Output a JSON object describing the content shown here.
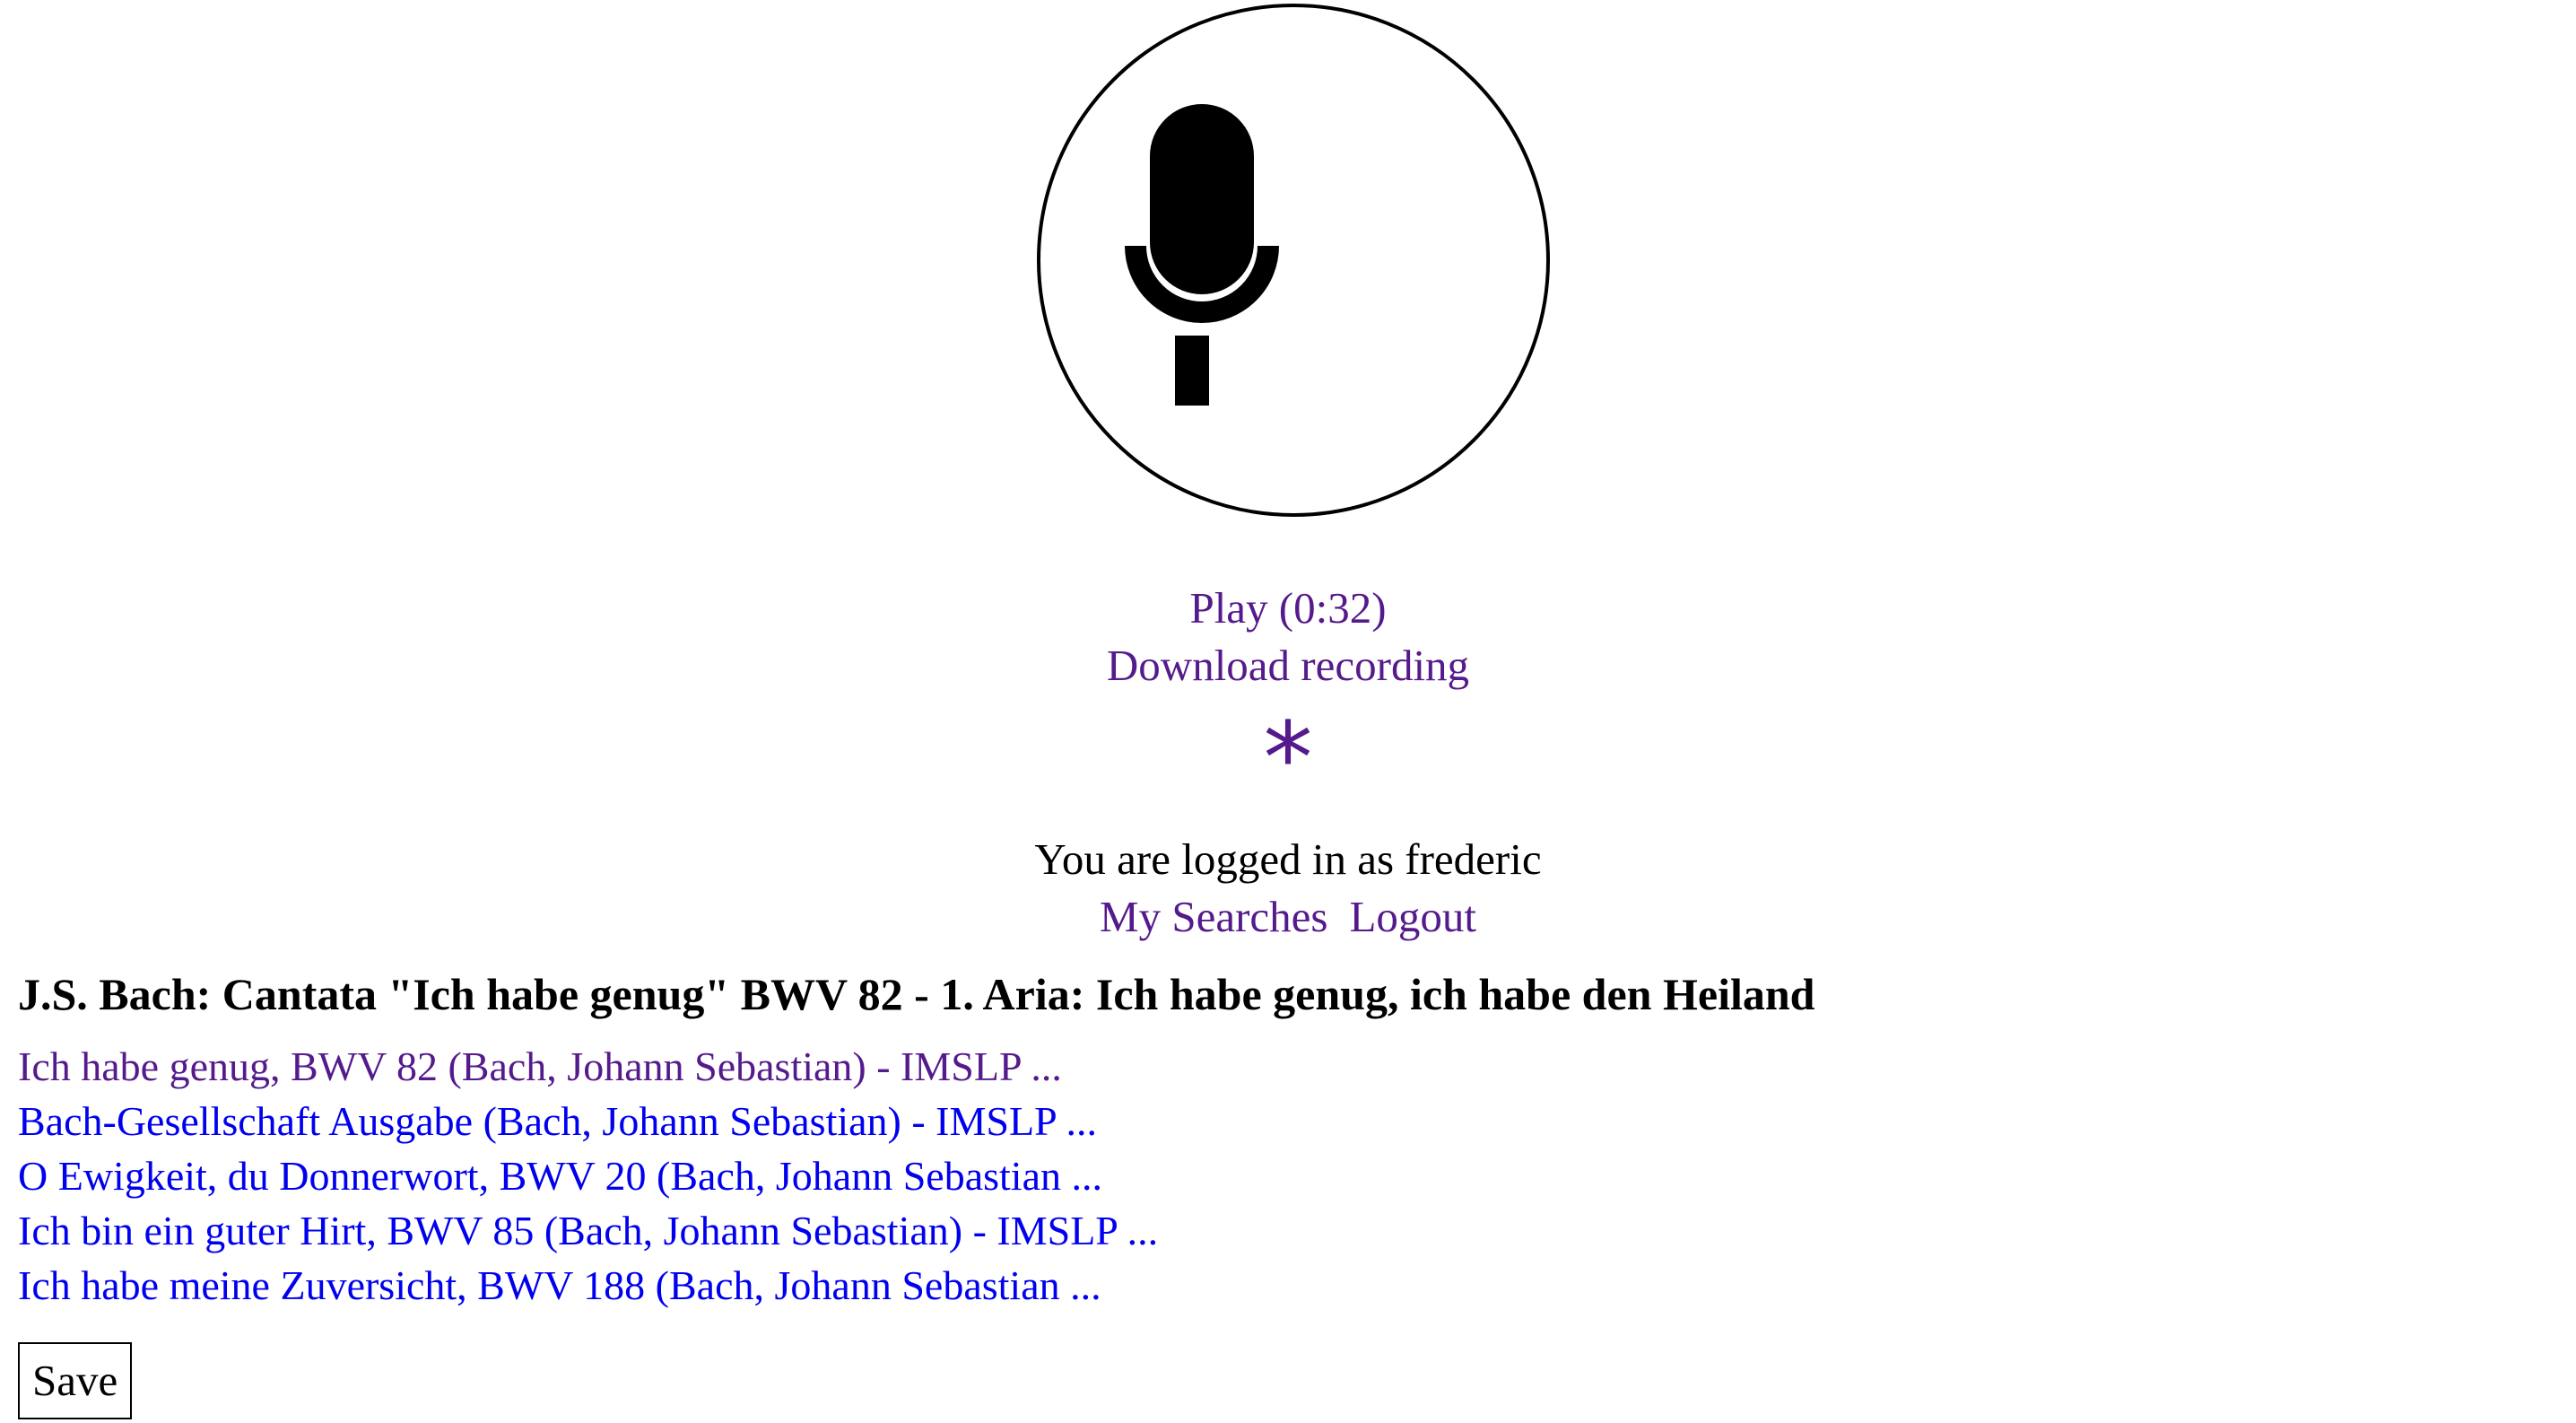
{
  "recorder": {
    "icon": "microphone-icon",
    "play_label": "Play (0:32)",
    "download_label": "Download recording",
    "busy_glyph": "*",
    "busy_icon": "asterisk-icon"
  },
  "session": {
    "status": "You are logged in as frederic",
    "my_searches_label": "My Searches",
    "logout_label": "Logout"
  },
  "result": {
    "title": "J.S. Bach: Cantata \"Ich habe genug\" BWV 82 - 1. Aria: Ich habe genug, ich habe den Heiland",
    "links": [
      {
        "label": "Ich habe genug, BWV 82 (Bach, Johann Sebastian) - IMSLP ...",
        "visited": true
      },
      {
        "label": "Bach-Gesellschaft Ausgabe (Bach, Johann Sebastian) - IMSLP ...",
        "visited": false
      },
      {
        "label": "O Ewigkeit, du Donnerwort, BWV 20 (Bach, Johann Sebastian ...",
        "visited": false
      },
      {
        "label": "Ich bin ein guter Hirt, BWV 85 (Bach, Johann Sebastian) - IMSLP ...",
        "visited": false
      },
      {
        "label": "Ich habe meine Zuversicht, BWV 188 (Bach, Johann Sebastian ...",
        "visited": false
      }
    ],
    "save_label": "Save"
  },
  "colors": {
    "visited_link": "#551a8b",
    "link": "#0000ee",
    "text": "#000000",
    "background": "#ffffff"
  }
}
